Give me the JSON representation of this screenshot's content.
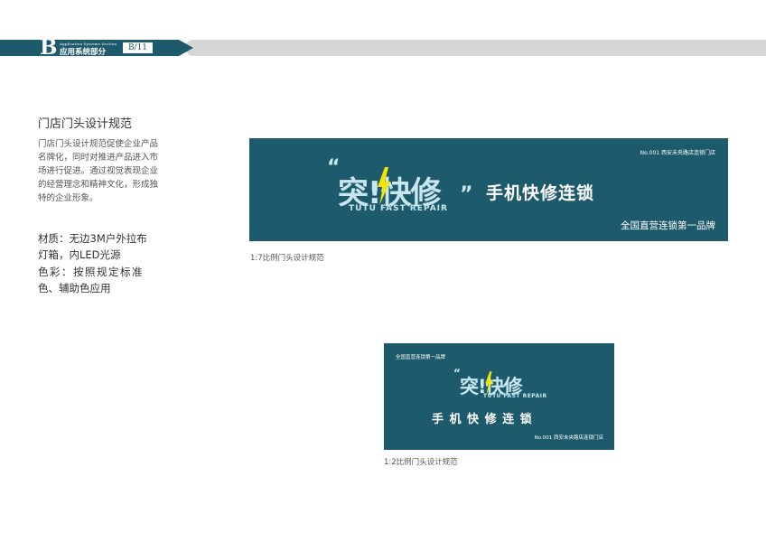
{
  "header": {
    "section_letter": "B",
    "section_en": "Application Systems Section",
    "section_cn": "应用系统部分",
    "page_number": "B/11"
  },
  "content": {
    "title": "门店门头设计规范",
    "description": "门店门头设计规范促使企业产品名牌化，同时对推进产品进入市场进行促进。通过视觉表现企业的经营理念和精神文化，形成独特的企业形象。",
    "spec_lines": [
      "材质：无边3M户外拉布",
      "灯箱，内LED光源",
      "色彩：按照规定标准",
      "色、辅助色应用"
    ]
  },
  "sign_large": {
    "store_no": "No.001 西安未央路店连锁门店",
    "logo_text": "突!快修",
    "logo_subtext": "TUTU FAST REPAIR",
    "slogan": "手机快修连锁",
    "tagline": "全国直营连锁第一品牌",
    "caption": "1:7比例门头设计规范"
  },
  "sign_small": {
    "tagline": "全国直营连锁第一品牌",
    "logo_text": "突!快修",
    "logo_subtext": "TUTU FAST REPAIR",
    "slogan": "手 机 快 修 连 锁",
    "store_no": "No.001 西安未央路店连锁门店",
    "caption": "1:2比例门头设计规范"
  },
  "colors": {
    "brand_teal": "#1d5a6b",
    "logo_light": "#c8e6ee",
    "bolt_yellow": "#f2e600",
    "header_grey": "#d6d6d6"
  }
}
